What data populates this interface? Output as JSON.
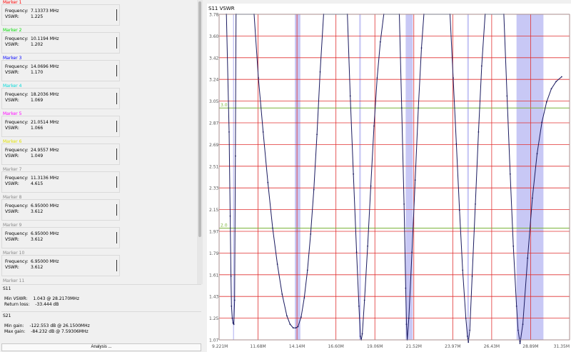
{
  "markers": [
    {
      "title": "Marker 1",
      "color": "#ff0000",
      "freq_label": "Frequency:",
      "freq": "7.13373 MHz",
      "vswr_label": "VSWR:",
      "vswr": "1.225"
    },
    {
      "title": "Marker 2",
      "color": "#00dd00",
      "freq_label": "Frequency:",
      "freq": "10.1194 MHz",
      "vswr_label": "VSWR:",
      "vswr": "1.202"
    },
    {
      "title": "Marker 3",
      "color": "#0000ff",
      "freq_label": "Frequency:",
      "freq": "14.0696 MHz",
      "vswr_label": "VSWR:",
      "vswr": "1.170"
    },
    {
      "title": "Marker 4",
      "color": "#00d8d8",
      "freq_label": "Frequency:",
      "freq": "18.2036 MHz",
      "vswr_label": "VSWR:",
      "vswr": "1.069"
    },
    {
      "title": "Marker 5",
      "color": "#ff00ff",
      "freq_label": "Frequency:",
      "freq": "21.0514 MHz",
      "vswr_label": "VSWR:",
      "vswr": "1.066"
    },
    {
      "title": "Marker 6",
      "color": "#e0e000",
      "freq_label": "Frequency:",
      "freq": "24.9557 MHz",
      "vswr_label": "VSWR:",
      "vswr": "1.049"
    },
    {
      "title": "Marker 7",
      "color": "#888888",
      "freq_label": "Frequency:",
      "freq": "11.3136 MHz",
      "vswr_label": "VSWR:",
      "vswr": "4.615"
    },
    {
      "title": "Marker 8",
      "color": "#888888",
      "freq_label": "Frequency:",
      "freq": "6.95000 MHz",
      "vswr_label": "VSWR:",
      "vswr": "3.612"
    },
    {
      "title": "Marker 9",
      "color": "#888888",
      "freq_label": "Frequency:",
      "freq": "6.95000 MHz",
      "vswr_label": "VSWR:",
      "vswr": "3.612"
    },
    {
      "title": "Marker 10",
      "color": "#888888",
      "freq_label": "Frequency:",
      "freq": "6.95000 MHz",
      "vswr_label": "VSWR:",
      "vswr": "3.612"
    },
    {
      "title": "Marker 11",
      "color": "#888888"
    }
  ],
  "s11": {
    "title": "S11",
    "min_vswr_label": "Min VSWR:",
    "min_vswr": "1.043 @ 28.2170MHz",
    "return_loss_label": "Return loss:",
    "return_loss": "-33.444 dB"
  },
  "s21": {
    "title": "S21",
    "min_gain_label": "Min gain:",
    "min_gain": "-122.553 dB @ 26.1500MHz",
    "max_gain_label": "Max gain:",
    "max_gain": "-84.232 dB @ 7.59306MHz"
  },
  "analysis_button": "Analysis ...",
  "chart_data": {
    "type": "line",
    "title": "S11 VSWR",
    "x_tick_labels": [
      "9.221M",
      "11.68M",
      "14.14M",
      "16.60M",
      "19.06M",
      "21.52M",
      "23.97M",
      "26.43M",
      "28.89M",
      "31.35M"
    ],
    "y_tick_labels": [
      "3.78",
      "3.60",
      "3.42",
      "3.24",
      "3.05",
      "2.87",
      "2.69",
      "2.51",
      "2.33",
      "2.15",
      "1.97",
      "1.79",
      "1.61",
      "1.43",
      "1.25",
      "1.07"
    ],
    "xlim": [
      9.221,
      31.35
    ],
    "ylim": [
      1.07,
      3.78
    ],
    "reference_lines": [
      {
        "label": "3.0",
        "value": 3.0,
        "color": "#7ab33a"
      },
      {
        "label": "2.0",
        "value": 2.0,
        "color": "#7ab33a"
      }
    ],
    "bands_mhz": [
      [
        10.1,
        10.15
      ],
      [
        14.0,
        14.35
      ],
      [
        18.068,
        18.168
      ],
      [
        21.0,
        21.45
      ],
      [
        24.89,
        24.99
      ],
      [
        28.0,
        29.7
      ]
    ],
    "band_color": "#c8c8f5",
    "grid_color": "#e03030",
    "line_color": "#1a1a60",
    "series": [
      {
        "x": [
          9.68,
          9.85,
          9.92,
          9.97,
          10.0,
          10.05,
          10.1,
          10.15,
          10.2,
          10.25,
          10.29,
          11.43,
          11.7,
          12.0,
          12.3,
          12.6,
          12.9,
          13.2,
          13.5,
          13.7,
          13.9,
          14.07,
          14.2,
          14.4,
          14.6,
          14.8,
          15.0,
          15.2,
          15.4,
          15.6,
          15.82,
          17.32,
          17.5,
          17.7,
          17.9,
          18.05,
          18.14,
          18.2,
          18.26,
          18.4,
          18.6,
          18.8,
          19.0,
          19.2,
          19.4,
          19.62,
          20.6,
          20.75,
          20.9,
          21.0,
          21.05,
          21.1,
          21.2,
          21.4,
          21.6,
          21.8,
          22.0,
          22.15,
          23.8,
          24.0,
          24.2,
          24.4,
          24.6,
          24.8,
          24.9,
          24.96,
          25.05,
          25.2,
          25.4,
          25.6,
          25.8,
          26.02,
          27.2,
          27.4,
          27.6,
          27.8,
          28.0,
          28.1,
          28.22,
          28.4,
          28.7,
          29.0,
          29.3,
          29.6,
          29.9,
          30.2,
          30.5,
          30.85
        ],
        "y": [
          3.78,
          2.8,
          2.1,
          1.6,
          1.35,
          1.25,
          1.21,
          1.2,
          1.4,
          2.6,
          3.78,
          3.78,
          3.25,
          2.8,
          2.38,
          2.0,
          1.7,
          1.45,
          1.27,
          1.2,
          1.17,
          1.17,
          1.18,
          1.26,
          1.42,
          1.65,
          1.95,
          2.32,
          2.78,
          3.3,
          3.78,
          3.78,
          3.1,
          2.45,
          1.8,
          1.35,
          1.1,
          1.07,
          1.12,
          1.4,
          1.85,
          2.35,
          2.85,
          3.25,
          3.55,
          3.78,
          3.78,
          3.0,
          2.2,
          1.5,
          1.2,
          1.07,
          1.25,
          1.8,
          2.4,
          3.0,
          3.5,
          3.78,
          3.78,
          3.25,
          2.7,
          2.15,
          1.65,
          1.25,
          1.1,
          1.05,
          1.15,
          1.6,
          2.2,
          2.8,
          3.35,
          3.78,
          3.78,
          3.1,
          2.45,
          1.85,
          1.35,
          1.15,
          1.04,
          1.2,
          1.75,
          2.25,
          2.62,
          2.88,
          3.05,
          3.16,
          3.22,
          3.26
        ]
      }
    ]
  }
}
